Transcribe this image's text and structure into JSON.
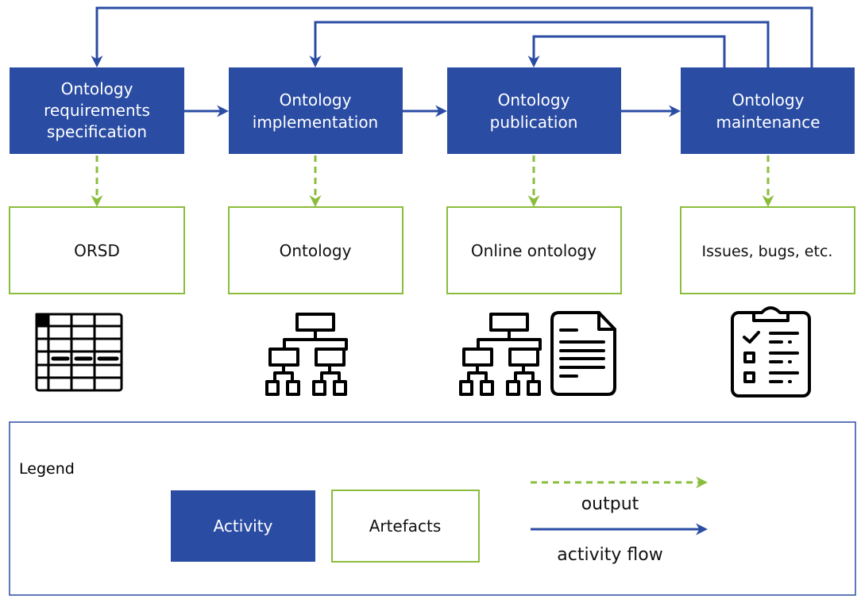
{
  "colors": {
    "activity": "#2a4ca3",
    "artefact_border": "#8bbd3c",
    "output_arrow": "#8bbd3c",
    "flow_arrow": "#2a4ca3"
  },
  "activities": [
    {
      "lines": [
        "Ontology",
        "requirements",
        "specification"
      ]
    },
    {
      "lines": [
        "Ontology",
        "implementation"
      ]
    },
    {
      "lines": [
        "Ontology",
        "publication"
      ]
    },
    {
      "lines": [
        "Ontology",
        "maintenance"
      ]
    }
  ],
  "artefacts": [
    {
      "label": "ORSD",
      "icon": "spreadsheet-icon"
    },
    {
      "label": "Ontology",
      "icon": "hierarchy-icon"
    },
    {
      "label": "Online ontology",
      "icon": "hierarchy-document-icon"
    },
    {
      "label": "Issues, bugs, etc.",
      "icon": "clipboard-checklist-icon"
    }
  ],
  "legend": {
    "title": "Legend",
    "activity": "Activity",
    "artefacts": "Artefacts",
    "output": "output",
    "activity_flow": "activity flow"
  }
}
